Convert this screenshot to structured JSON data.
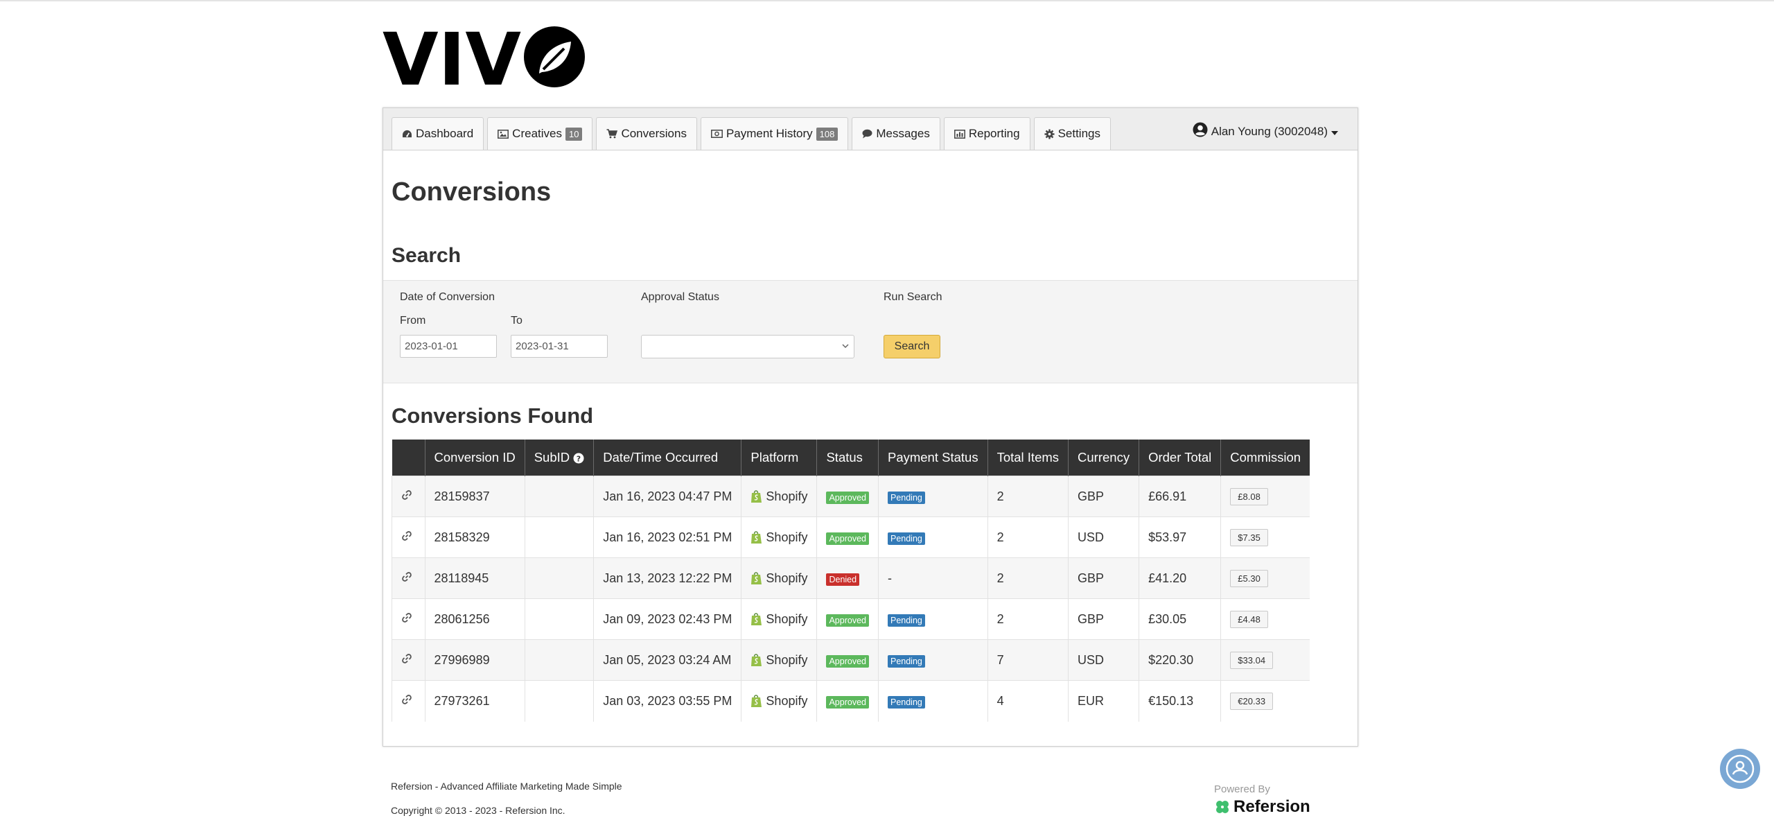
{
  "brand": {
    "logo_text": "VIVO"
  },
  "nav": {
    "tabs": [
      {
        "label": "Dashboard",
        "icon": "dashboard-icon"
      },
      {
        "label": "Creatives",
        "icon": "image-icon",
        "badge": "10"
      },
      {
        "label": "Conversions",
        "icon": "cart-icon"
      },
      {
        "label": "Payment History",
        "icon": "money-icon",
        "badge": "108"
      },
      {
        "label": "Messages",
        "icon": "chat-icon"
      },
      {
        "label": "Reporting",
        "icon": "bar-chart-icon"
      },
      {
        "label": "Settings",
        "icon": "gear-icon"
      }
    ],
    "user": "Alan Young (3002048)"
  },
  "page": {
    "title": "Conversions"
  },
  "search": {
    "heading": "Search",
    "date_label": "Date of Conversion",
    "from_label": "From",
    "to_label": "To",
    "from_value": "2023-01-01",
    "to_value": "2023-01-31",
    "approval_label": "Approval Status",
    "approval_value": "",
    "run_label": "Run Search",
    "button": "Search"
  },
  "results": {
    "heading": "Conversions Found",
    "columns": [
      "",
      "Conversion ID",
      "SubID",
      "Date/Time Occurred",
      "Platform",
      "Status",
      "Payment Status",
      "Total Items",
      "Currency",
      "Order Total",
      "Commission"
    ],
    "rows": [
      {
        "id": "28159837",
        "subid": "",
        "date": "Jan 16, 2023 04:47 PM",
        "platform": "Shopify",
        "status": "Approved",
        "payment": "Pending",
        "items": "2",
        "currency": "GBP",
        "total": "£66.91",
        "commission": "£8.08"
      },
      {
        "id": "28158329",
        "subid": "",
        "date": "Jan 16, 2023 02:51 PM",
        "platform": "Shopify",
        "status": "Approved",
        "payment": "Pending",
        "items": "2",
        "currency": "USD",
        "total": "$53.97",
        "commission": "$7.35"
      },
      {
        "id": "28118945",
        "subid": "",
        "date": "Jan 13, 2023 12:22 PM",
        "platform": "Shopify",
        "status": "Denied",
        "payment": "-",
        "items": "2",
        "currency": "GBP",
        "total": "£41.20",
        "commission": "£5.30"
      },
      {
        "id": "28061256",
        "subid": "",
        "date": "Jan 09, 2023 02:43 PM",
        "platform": "Shopify",
        "status": "Approved",
        "payment": "Pending",
        "items": "2",
        "currency": "GBP",
        "total": "£30.05",
        "commission": "£4.48"
      },
      {
        "id": "27996989",
        "subid": "",
        "date": "Jan 05, 2023 03:24 AM",
        "platform": "Shopify",
        "status": "Approved",
        "payment": "Pending",
        "items": "7",
        "currency": "USD",
        "total": "$220.30",
        "commission": "$33.04"
      },
      {
        "id": "27973261",
        "subid": "",
        "date": "Jan 03, 2023 03:55 PM",
        "platform": "Shopify",
        "status": "Approved",
        "payment": "Pending",
        "items": "4",
        "currency": "EUR",
        "total": "€150.13",
        "commission": "€20.33"
      }
    ]
  },
  "colors": {
    "approved": "#5cb85c",
    "denied": "#c9302c",
    "pending": "#337ab7",
    "header": "#333333",
    "search_button": "#f5cf6a",
    "shopify": "#95bf47"
  },
  "footer": {
    "tagline": "Refersion - Advanced Affiliate Marketing Made Simple",
    "copyright": "Copyright © 2013 - 2023 - Refersion Inc.",
    "powered": "Powered By",
    "brand": "Refersion"
  }
}
